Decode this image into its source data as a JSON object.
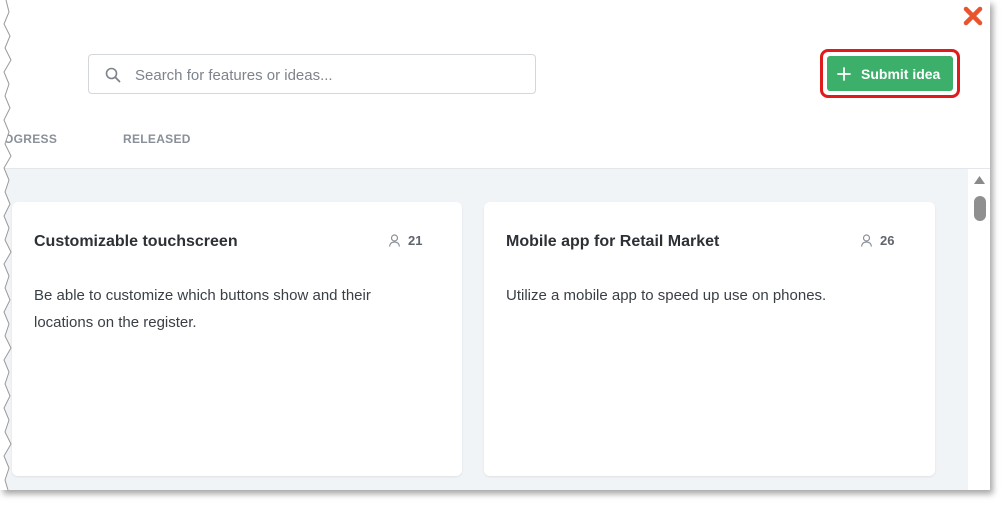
{
  "search": {
    "placeholder": "Search for features or ideas..."
  },
  "submit": {
    "label": "Submit idea"
  },
  "tabs": [
    {
      "label": "OGRESS"
    },
    {
      "label": "RELEASED"
    }
  ],
  "cards": [
    {
      "title": "Customizable touchscreen",
      "votes": "21",
      "description": "Be able to customize which buttons show and their locations on the register."
    },
    {
      "title": "Mobile app for Retail Market",
      "votes": "26",
      "description": "Utilize a mobile app to speed up use on phones."
    }
  ],
  "colors": {
    "accent": "#3caf6a",
    "highlight": "#e01b1b",
    "close": "#e8542e",
    "board_bg": "#f1f4f7"
  },
  "icons": {
    "close": "close-icon",
    "search": "search-icon",
    "plus": "plus-icon",
    "vote": "user-icon"
  }
}
